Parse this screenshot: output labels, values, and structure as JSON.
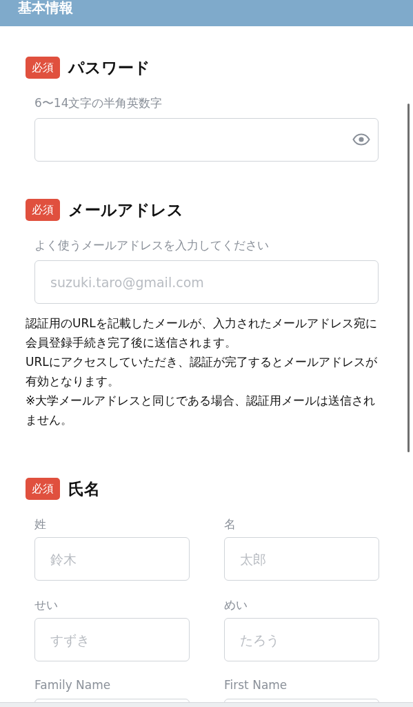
{
  "header": {
    "title": "基本情報"
  },
  "sections": [
    {
      "kind": "password",
      "badge": "必須",
      "title": "パスワード",
      "hint": "6〜14文字の半角英数字",
      "field": {
        "masked": true
      }
    },
    {
      "kind": "email",
      "badge": "必須",
      "title": "メールアドレス",
      "hint": "よく使うメールアドレスを入力してください",
      "field": {
        "placeholder": "suzuki.taro@gmail.com"
      },
      "notes": [
        "認証用のURLを記載したメールが、入力されたメールアドレス宛に会員登録手続き完了後に送信されます。",
        "URLにアクセスしていただき、認証が完了するとメールアドレスが有効となります。",
        "※大学メールアドレスと同じである場合、認証用メールは送信されません。"
      ]
    },
    {
      "kind": "name",
      "badge": "必須",
      "title": "氏名",
      "fields": [
        {
          "label": "姓",
          "placeholder": "鈴木"
        },
        {
          "label": "名",
          "placeholder": "太郎"
        },
        {
          "label": "せい",
          "placeholder": "すずき"
        },
        {
          "label": "めい",
          "placeholder": "たろう"
        },
        {
          "label": "Family Name"
        },
        {
          "label": "First Name"
        }
      ]
    }
  ]
}
